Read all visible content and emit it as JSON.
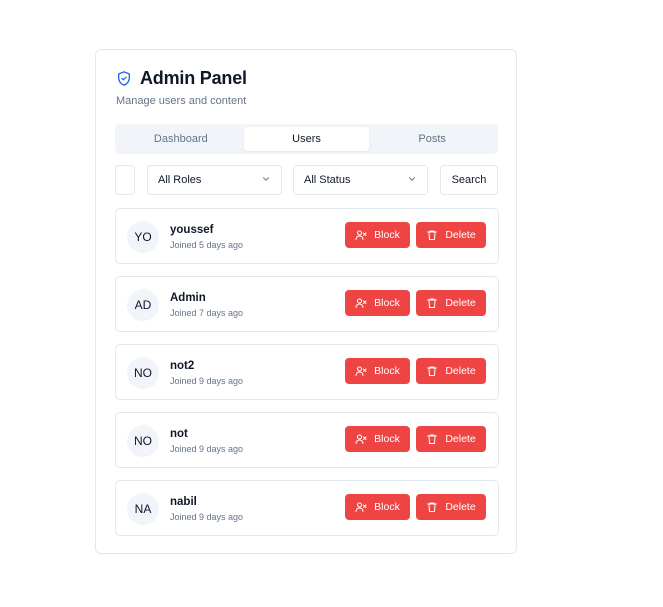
{
  "header": {
    "title": "Admin Panel",
    "subtitle": "Manage users and content",
    "icon": "shield-check-icon",
    "accent_color": "#2563eb"
  },
  "tabs": [
    {
      "label": "Dashboard",
      "active": false
    },
    {
      "label": "Users",
      "active": true
    },
    {
      "label": "Posts",
      "active": false
    }
  ],
  "filters": {
    "search_value": "",
    "roles_selected": "All Roles",
    "status_selected": "All Status",
    "search_button": "Search"
  },
  "actions": {
    "block_label": "Block",
    "delete_label": "Delete",
    "danger_color": "#ef4444"
  },
  "users": [
    {
      "initials": "YO",
      "name": "youssef",
      "joined": "Joined 5 days ago"
    },
    {
      "initials": "AD",
      "name": "Admin",
      "joined": "Joined 7 days ago"
    },
    {
      "initials": "NO",
      "name": "not2",
      "joined": "Joined 9 days ago"
    },
    {
      "initials": "NO",
      "name": "not",
      "joined": "Joined 9 days ago"
    },
    {
      "initials": "NA",
      "name": "nabil",
      "joined": "Joined 9 days ago"
    }
  ]
}
